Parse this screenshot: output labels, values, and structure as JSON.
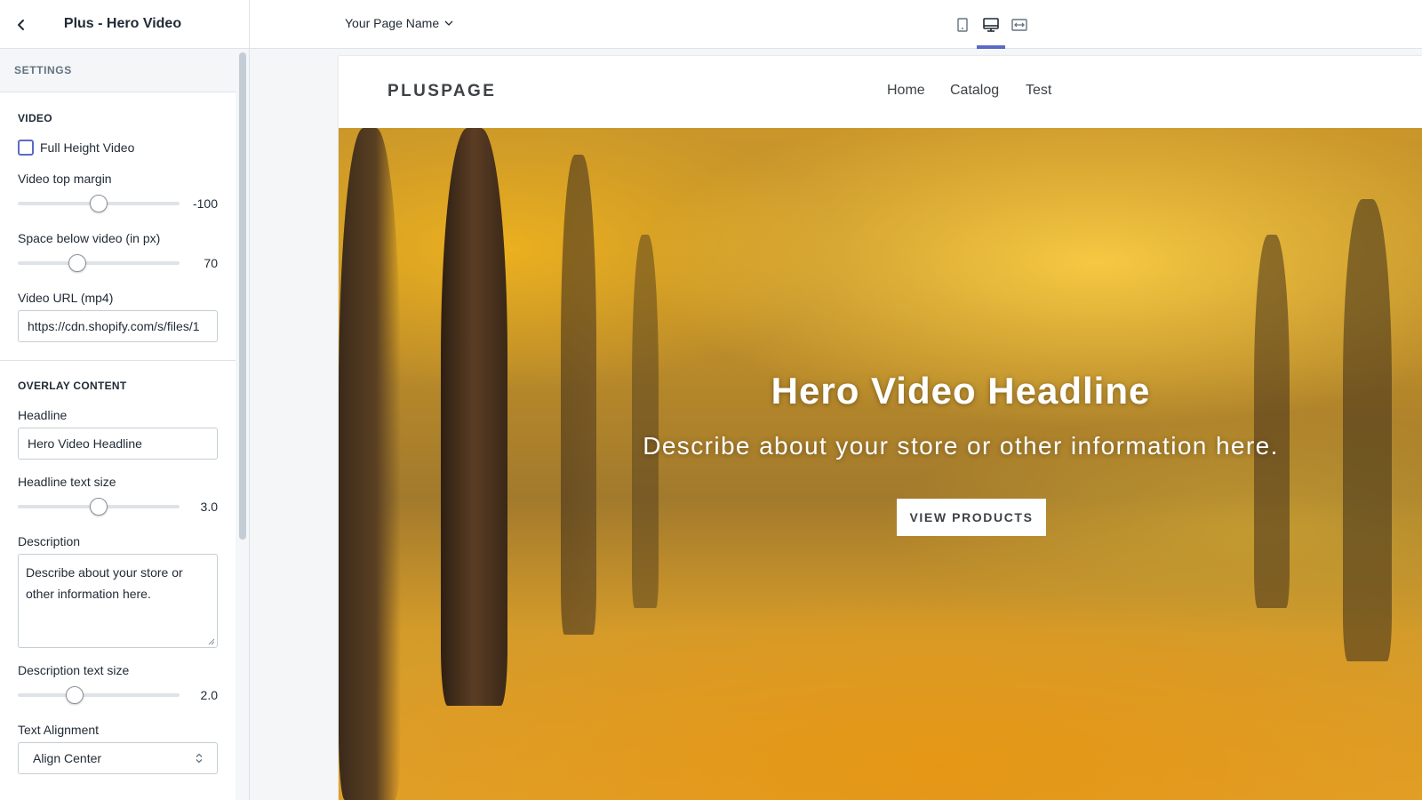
{
  "sidebar": {
    "title": "Plus - Hero Video",
    "settings_label": "SETTINGS",
    "video_section": {
      "title": "VIDEO",
      "full_height_label": "Full Height Video",
      "full_height_checked": false,
      "top_margin_label": "Video top margin",
      "top_margin_value": "-100",
      "top_margin_fraction": 0.5,
      "space_below_label": "Space below video (in px)",
      "space_below_value": "70",
      "space_below_fraction": 0.37,
      "url_label": "Video URL (mp4)",
      "url_value": "https://cdn.shopify.com/s/files/1"
    },
    "overlay_section": {
      "title": "OVERLAY CONTENT",
      "headline_label": "Headline",
      "headline_value": "Hero Video Headline",
      "headline_size_label": "Headline text size",
      "headline_size_value": "3.0",
      "headline_size_fraction": 0.5,
      "description_label": "Description",
      "description_value": "Describe about your store or other information here.",
      "description_size_label": "Description text size",
      "description_size_value": "2.0",
      "description_size_fraction": 0.35,
      "alignment_label": "Text Alignment",
      "alignment_value": "Align Center"
    }
  },
  "topbar": {
    "page_name": "Your Page Name",
    "viewports": [
      "mobile-icon",
      "desktop-icon",
      "fullwidth-icon"
    ],
    "active_viewport": "desktop"
  },
  "preview": {
    "logo": "PLUSPAGE",
    "nav": [
      "Home",
      "Catalog",
      "Test"
    ],
    "hero_headline": "Hero Video Headline",
    "hero_description": "Describe about your store or other information here.",
    "hero_button": "VIEW PRODUCTS"
  },
  "colors": {
    "accent": "#5c6ac4",
    "text": "#212b36",
    "border": "#dfe3e8"
  }
}
